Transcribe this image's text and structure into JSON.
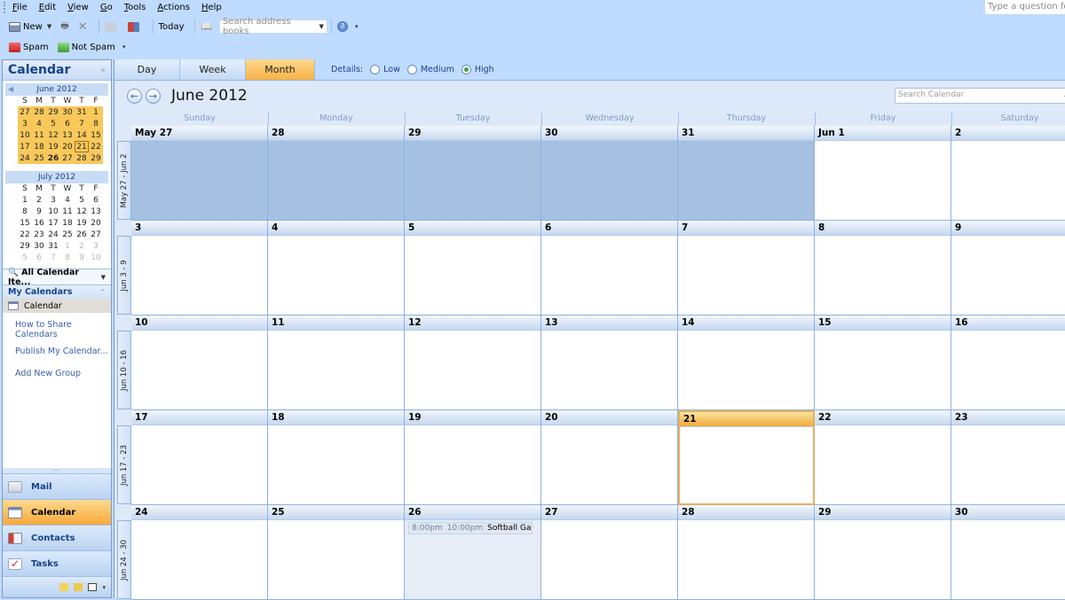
{
  "menu": [
    "File",
    "Edit",
    "View",
    "Go",
    "Tools",
    "Actions",
    "Help"
  ],
  "ask_box": {
    "placeholder": "Type a question for help"
  },
  "toolbar": {
    "new_label": "New",
    "today_label": "Today",
    "search_address_placeholder": "Search address books",
    "spam_label": "Spam",
    "not_spam_label": "Not Spam"
  },
  "nav": {
    "title": "Calendar",
    "collapse_icon": "double-chevron-left-icon",
    "mini_months": [
      {
        "title": "June 2012",
        "headers": [
          "S",
          "M",
          "T",
          "W",
          "T",
          "F"
        ],
        "weeks": [
          [
            "27",
            "28",
            "29",
            "30",
            "31",
            "1"
          ],
          [
            "3",
            "4",
            "5",
            "6",
            "7",
            "8"
          ],
          [
            "10",
            "11",
            "12",
            "13",
            "14",
            "15"
          ],
          [
            "17",
            "18",
            "19",
            "20",
            "21",
            "22"
          ],
          [
            "24",
            "25",
            "26",
            "27",
            "28",
            "29"
          ]
        ],
        "today": "21",
        "bold": "26"
      },
      {
        "title": "July 2012",
        "headers": [
          "S",
          "M",
          "T",
          "W",
          "T",
          "F"
        ],
        "weeks": [
          [
            "1",
            "2",
            "3",
            "4",
            "5",
            "6"
          ],
          [
            "8",
            "9",
            "10",
            "11",
            "12",
            "13"
          ],
          [
            "15",
            "16",
            "17",
            "18",
            "19",
            "20"
          ],
          [
            "22",
            "23",
            "24",
            "25",
            "26",
            "27"
          ],
          [
            "29",
            "30",
            "31",
            "1",
            "2",
            "3"
          ],
          [
            "5",
            "6",
            "7",
            "8",
            "9",
            "10"
          ]
        ]
      }
    ],
    "view_selector": "All Calendar Ite...",
    "my_calendars_label": "My Calendars",
    "calendar_item": "Calendar",
    "links": [
      "How to Share Calendars",
      "Publish My Calendar...",
      "Add New Group"
    ],
    "buttons": [
      {
        "label": "Mail",
        "icon": "mail-icon",
        "active": false
      },
      {
        "label": "Calendar",
        "icon": "calendar-icon",
        "active": true
      },
      {
        "label": "Contacts",
        "icon": "contacts-icon",
        "active": false
      },
      {
        "label": "Tasks",
        "icon": "tasks-icon",
        "active": false
      }
    ]
  },
  "view": {
    "tabs": [
      "Day",
      "Week",
      "Month"
    ],
    "active_tab": "Month",
    "details_label": "Details:",
    "details_options": [
      "Low",
      "Medium",
      "High"
    ],
    "details_selected": "High",
    "title": "June 2012",
    "search_placeholder": "Search Calendar"
  },
  "month": {
    "weekdays": [
      "Sunday",
      "Monday",
      "Tuesday",
      "Wednesday",
      "Thursday",
      "Friday",
      "Saturday"
    ],
    "weeks": [
      {
        "label": "May 27 - Jun 2",
        "days": [
          "May 27",
          "28",
          "29",
          "30",
          "31",
          "Jun 1",
          "2"
        ]
      },
      {
        "label": "Jun 3 - 9",
        "days": [
          "3",
          "4",
          "5",
          "6",
          "7",
          "8",
          "9"
        ]
      },
      {
        "label": "Jun 10 - 16",
        "days": [
          "10",
          "11",
          "12",
          "13",
          "14",
          "15",
          "16"
        ]
      },
      {
        "label": "Jun 17 - 23",
        "days": [
          "17",
          "18",
          "19",
          "20",
          "21",
          "22",
          "23"
        ]
      },
      {
        "label": "Jun 24 - 30",
        "days": [
          "24",
          "25",
          "26",
          "27",
          "28",
          "29",
          "30"
        ]
      }
    ],
    "today": "21",
    "selected": "26",
    "appointments": [
      {
        "day": "26",
        "start": "8:00pm",
        "end": "10:00pm",
        "subject": "Softball Ga"
      }
    ]
  }
}
